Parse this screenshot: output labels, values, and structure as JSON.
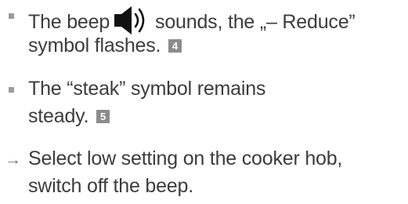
{
  "items": [
    {
      "line1_before_icon": "The beep",
      "icon": "speaker-icon",
      "line1_after_icon": "sounds, the „– Reduce”",
      "line2_text": "symbol flashes.",
      "badge": "4"
    },
    {
      "line1": "The “steak” symbol remains",
      "line2_text": "steady.",
      "badge": "5"
    }
  ],
  "instruction": {
    "arrow": "→",
    "line1": "Select low setting on the cooker hob,",
    "line2": "switch off the beep."
  }
}
